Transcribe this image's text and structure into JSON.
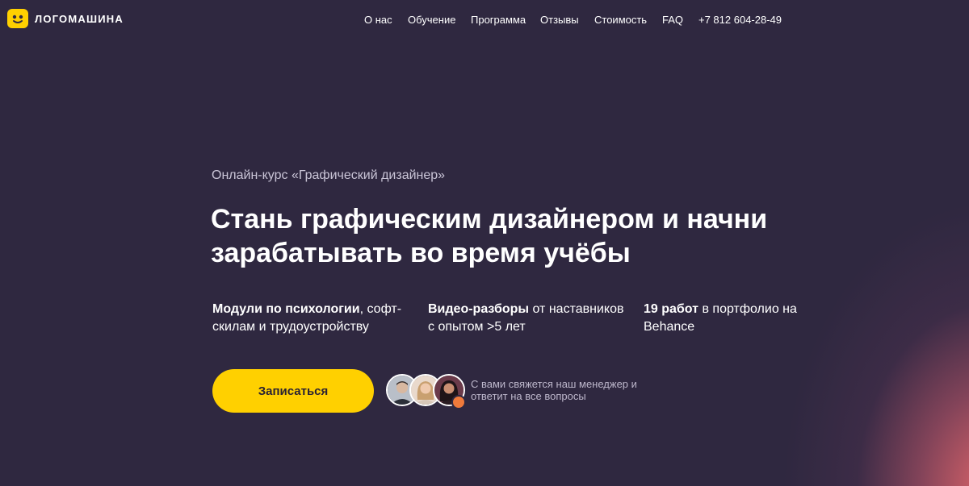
{
  "brand": {
    "name": "ЛОГОМАШИНА",
    "badge_icon": "smiley-icon",
    "badge_color": "#ffd000"
  },
  "nav": {
    "items": [
      {
        "label": "О нас"
      },
      {
        "label": "Обучение"
      },
      {
        "label": "Программа"
      },
      {
        "label": "Отзывы"
      },
      {
        "label": "Стоимость"
      },
      {
        "label": "FAQ"
      },
      {
        "label": "+7 812 604-28-49"
      }
    ]
  },
  "hero": {
    "subtitle": "Онлайн-курс «Графический дизайнер»",
    "title": "Стань графическим дизайнером и начни зарабатывать во время учёбы",
    "features": [
      {
        "bold": "Модули по психологии",
        "rest": ", софт-скилам и трудоустройству"
      },
      {
        "bold": "Видео-разборы",
        "rest": " от наставников с опытом >5 лет"
      },
      {
        "bold": "19 работ",
        "rest": " в портфолио на Behance"
      }
    ],
    "cta_label": "Записаться",
    "manager_note": "С вами свяжется наш менеджер и ответит на все вопросы"
  },
  "colors": {
    "background": "#2f2840",
    "accent": "#ffd000",
    "glow": "#e8686c",
    "muted_text": "#bdb7cb"
  }
}
